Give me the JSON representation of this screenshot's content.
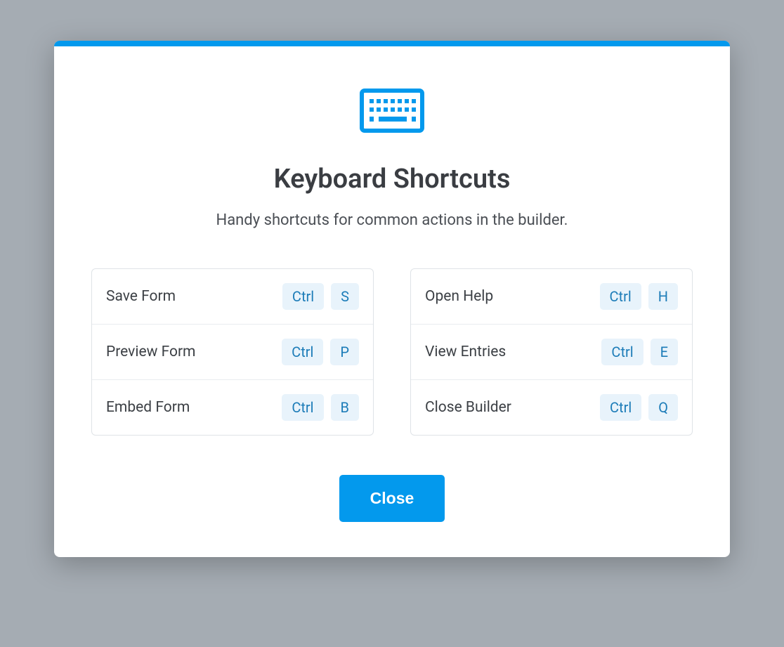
{
  "modal": {
    "title": "Keyboard Shortcuts",
    "subtitle": "Handy shortcuts for common actions in the builder.",
    "close_label": "Close"
  },
  "colors": {
    "accent": "#0399ed",
    "key_bg": "#e8f3fb",
    "key_text": "#1c7cb8"
  },
  "shortcuts_left": [
    {
      "label": "Save Form",
      "modifier": "Ctrl",
      "key": "S"
    },
    {
      "label": "Preview Form",
      "modifier": "Ctrl",
      "key": "P"
    },
    {
      "label": "Embed Form",
      "modifier": "Ctrl",
      "key": "B"
    }
  ],
  "shortcuts_right": [
    {
      "label": "Open Help",
      "modifier": "Ctrl",
      "key": "H"
    },
    {
      "label": "View Entries",
      "modifier": "Ctrl",
      "key": "E"
    },
    {
      "label": "Close Builder",
      "modifier": "Ctrl",
      "key": "Q"
    }
  ]
}
